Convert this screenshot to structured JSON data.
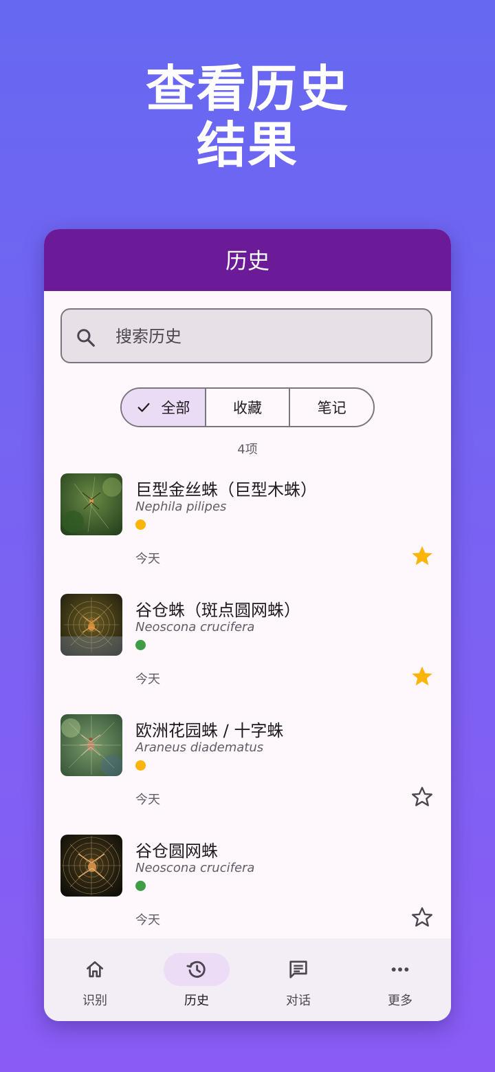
{
  "promo": {
    "title_line1": "查看历史",
    "title_line2": "结果"
  },
  "app_bar": {
    "title": "历史"
  },
  "search": {
    "placeholder": "搜索历史"
  },
  "filter": {
    "options": [
      {
        "label": "全部",
        "selected": true
      },
      {
        "label": "收藏",
        "selected": false
      },
      {
        "label": "笔记",
        "selected": false
      }
    ]
  },
  "count_text": "4项",
  "history": [
    {
      "title": "巨型金丝蛛（巨型木蛛）",
      "scientific_name": "Nephila pilipes",
      "date": "今天",
      "status_color": "#fbb40a",
      "favorited": true
    },
    {
      "title": "谷仓蛛（斑点圆网蛛）",
      "scientific_name": "Neoscona crucifera",
      "date": "今天",
      "status_color": "#3f9c47",
      "favorited": true
    },
    {
      "title": "欧洲花园蛛 / 十字蛛",
      "scientific_name": "Araneus diadematus",
      "date": "今天",
      "status_color": "#fbb40a",
      "favorited": false
    },
    {
      "title": "谷仓圆网蛛",
      "scientific_name": "Neoscona crucifera",
      "date": "今天",
      "status_color": "#3f9c47",
      "favorited": false
    }
  ],
  "nav": [
    {
      "label": "识别",
      "icon": "home-icon",
      "active": false
    },
    {
      "label": "历史",
      "icon": "history-icon",
      "active": true
    },
    {
      "label": "对话",
      "icon": "chat-icon",
      "active": false
    },
    {
      "label": "更多",
      "icon": "more-horizontal-icon",
      "active": false
    }
  ],
  "colors": {
    "app_bar": "#6b1b98",
    "favorite_star": "#fbb40a",
    "background_gradient_top": "#6668f1",
    "background_gradient_bottom": "#8a5cf5"
  }
}
